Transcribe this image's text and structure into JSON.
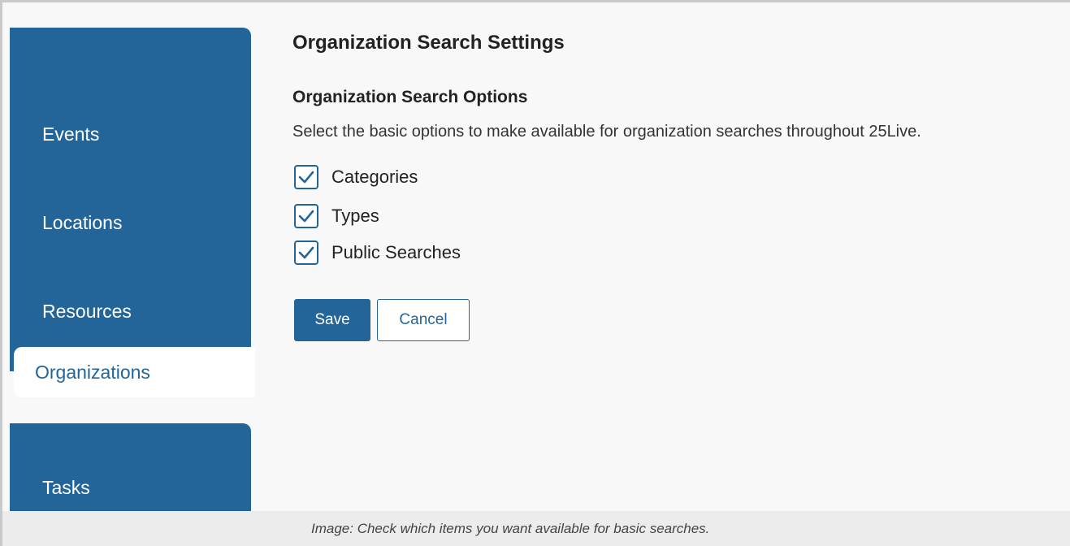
{
  "sidebar": {
    "items": [
      {
        "label": "Events"
      },
      {
        "label": "Locations"
      },
      {
        "label": "Resources"
      },
      {
        "label": "Organizations",
        "active": true
      },
      {
        "label": "Tasks"
      }
    ],
    "color": "#236599"
  },
  "main": {
    "title": "Organization Search Settings",
    "section_title": "Organization Search Options",
    "description": "Select the basic options to make available for organization searches throughout 25Live.",
    "options": [
      {
        "label": "Categories",
        "checked": true,
        "icon": "checkmark-icon"
      },
      {
        "label": "Types",
        "checked": true,
        "icon": "checkmark-icon"
      },
      {
        "label": "Public Searches",
        "checked": true,
        "icon": "checkmark-icon"
      }
    ],
    "save_label": "Save",
    "cancel_label": "Cancel"
  },
  "caption": "Image: Check which items you want available for basic searches."
}
